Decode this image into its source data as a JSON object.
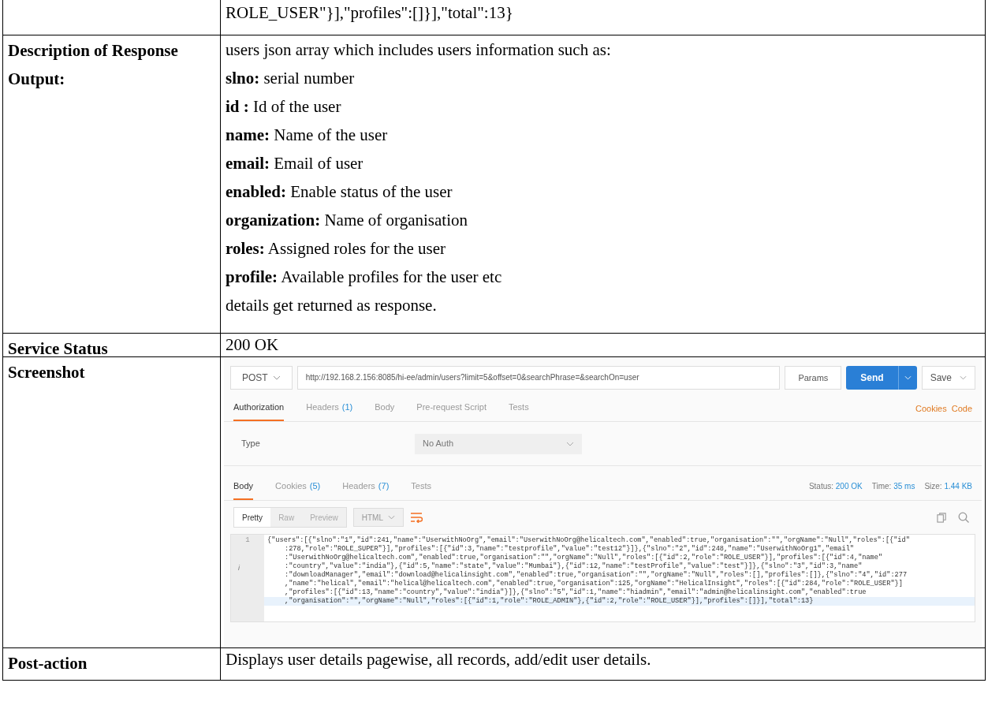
{
  "table": {
    "rows": [
      {
        "label": "",
        "value": "ROLE_USER\"}],\"profiles\":[]}],\"total\":13}"
      },
      {
        "label": "Description of Response Output:",
        "lines": [
          "users json array which includes users information such as:",
          "**slno:** serial number",
          "**id :** Id of the user",
          "**name:** Name of the user",
          "**email:** Email of user",
          "**enabled:** Enable status of the user",
          "**organization:** Name of organisation",
          "**roles:** Assigned roles for the user",
          "**profile:** Available profiles for the user etc",
          "details get returned as response."
        ]
      },
      {
        "label": "Service Status",
        "value": "200 OK"
      },
      {
        "label": "Screenshot",
        "kind": "screenshot"
      },
      {
        "label": "Post-action",
        "value": "Displays user details pagewise, all records, add/edit user details."
      }
    ]
  },
  "screenshot": {
    "method": "POST",
    "url": "http://192.168.2.156:8085/hi-ee/admin/users?limit=5&offset=0&searchPhrase=&searchOn=user",
    "params_button": "Params",
    "send_button": "Send",
    "save_button": "Save",
    "request_tabs": [
      {
        "label": "Authorization",
        "selected": true
      },
      {
        "label": "Headers",
        "count": "(1)",
        "selected": false
      },
      {
        "label": "Body",
        "selected": false
      },
      {
        "label": "Pre-request Script",
        "selected": false
      },
      {
        "label": "Tests",
        "selected": false
      }
    ],
    "request_links": [
      "Cookies",
      "Code"
    ],
    "auth": {
      "label": "Type",
      "value": "No Auth"
    },
    "response_tabs": [
      {
        "label": "Body",
        "selected": true
      },
      {
        "label": "Cookies",
        "count": "(5)",
        "selected": false
      },
      {
        "label": "Headers",
        "count": "(7)",
        "selected": false
      },
      {
        "label": "Tests",
        "selected": false
      }
    ],
    "stats": [
      {
        "label": "Status:",
        "value": "200 OK"
      },
      {
        "label": "Time:",
        "value": "35 ms"
      },
      {
        "label": "Size:",
        "value": "1.44 KB"
      }
    ],
    "view_modes": [
      {
        "label": "Pretty",
        "selected": true
      },
      {
        "label": "Raw",
        "selected": false
      },
      {
        "label": "Preview",
        "selected": false
      }
    ],
    "format": "HTML",
    "code": {
      "line_number": "1",
      "marker": "i",
      "lines": [
        {
          "text": "{\"users\":[{\"slno\":\"1\",\"id\":241,\"name\":\"UserwithNoOrg\",\"email\":\"UserwithNoOrg@helicaltech.com\",\"enabled\":true,\"organisation\":\"\",\"orgName\":\"Null\",\"roles\":[{\"id\"",
          "current": false
        },
        {
          "text": ":278,\"role\":\"ROLE_SUPER\"}],\"profiles\":[{\"id\":3,\"name\":\"testprofile\",\"value\":\"test12\"}]},{\"slno\":\"2\",\"id\":248,\"name\":\"UserwithNoOrg1\",\"email\"",
          "current": false
        },
        {
          "text": ":\"UserwithNoOrg@helicaltech.com\",\"enabled\":true,\"organisation\":\"\",\"orgName\":\"Null\",\"roles\":[{\"id\":2,\"role\":\"ROLE_USER\"}],\"profiles\":[{\"id\":4,\"name\"",
          "current": false
        },
        {
          "text": ":\"country\",\"value\":\"india\"},{\"id\":5,\"name\":\"state\",\"value\":\"Mumbai\"},{\"id\":12,\"name\":\"testProfile\",\"value\":\"test\"}]},{\"slno\":\"3\",\"id\":3,\"name\"",
          "current": false
        },
        {
          "text": ":\"downloadManager\",\"email\":\"download@helicalinsight.com\",\"enabled\":true,\"organisation\":\"\",\"orgName\":\"Null\",\"roles\":[],\"profiles\":[]},{\"slno\":\"4\",\"id\":277",
          "current": false
        },
        {
          "text": ",\"name\":\"helical\",\"email\":\"helical@helicaltech.com\",\"enabled\":true,\"organisation\":125,\"orgName\":\"HelicalInsight\",\"roles\":[{\"id\":284,\"role\":\"ROLE_USER\"}]",
          "current": false
        },
        {
          "text": ",\"profiles\":[{\"id\":13,\"name\":\"country\",\"value\":\"india\"}]},{\"slno\":\"5\",\"id\":1,\"name\":\"hiadmin\",\"email\":\"admin@helicalinsight.com\",\"enabled\":true",
          "current": false
        },
        {
          "text": ",\"organisation\":\"\",\"orgName\":\"Null\",\"roles\":[{\"id\":1,\"role\":\"ROLE_ADMIN\"},{\"id\":2,\"role\":\"ROLE_USER\"}],\"profiles\":[]}],\"total\":13}",
          "current": true
        }
      ]
    }
  }
}
